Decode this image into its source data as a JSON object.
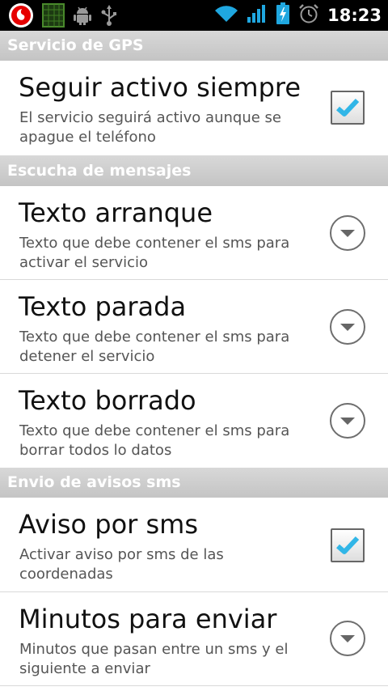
{
  "status_bar": {
    "time": "18:23",
    "icons": [
      "vodafone-logo-icon",
      "signal-app-icon",
      "android-icon",
      "usb-icon",
      "wifi-icon",
      "cell-signal-icon",
      "battery-charging-icon",
      "alarm-icon"
    ]
  },
  "sections": [
    {
      "header": "Servicio de GPS",
      "items": [
        {
          "title": "Seguir activo siempre",
          "summary": "El servicio seguirá activo aunque se apague el teléfono",
          "widget": "checkbox",
          "checked": true
        }
      ]
    },
    {
      "header": "Escucha de mensajes",
      "items": [
        {
          "title": "Texto arranque",
          "summary": "Texto que debe contener el sms para activar el servicio",
          "widget": "dropdown"
        },
        {
          "title": "Texto parada",
          "summary": "Texto que debe contener el sms para detener el servicio",
          "widget": "dropdown"
        },
        {
          "title": "Texto borrado",
          "summary": "Texto que debe contener el sms para borrar todos lo datos",
          "widget": "dropdown"
        }
      ]
    },
    {
      "header": "Envio de avisos sms",
      "items": [
        {
          "title": "Aviso por sms",
          "summary": "Activar aviso por sms de las coordenadas",
          "widget": "checkbox",
          "checked": true
        },
        {
          "title": "Minutos para enviar",
          "summary": "Minutos que pasan entre un sms y el siguiente a enviar",
          "widget": "dropdown"
        }
      ]
    }
  ],
  "colors": {
    "accent_check": "#31b6e7",
    "section_header": "#cacaca",
    "status_bar": "#000000"
  }
}
